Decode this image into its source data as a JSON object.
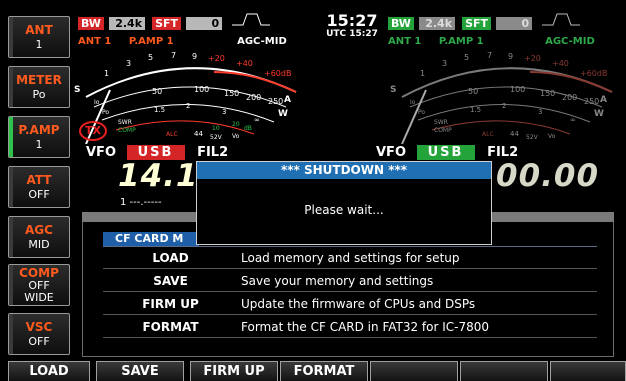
{
  "side_buttons": [
    {
      "title": "ANT",
      "value": "1"
    },
    {
      "title": "METER",
      "value": "Po"
    },
    {
      "title": "P.AMP",
      "value": "1"
    },
    {
      "title": "ATT",
      "value": "OFF"
    },
    {
      "title": "AGC",
      "value": "MID"
    },
    {
      "title": "COMP",
      "value": "OFF",
      "value2": "WIDE"
    },
    {
      "title": "VSC",
      "value": "OFF"
    }
  ],
  "left_top": {
    "bw_label": "BW",
    "bw_value": "2.4k",
    "sft_label": "SFT",
    "sft_value": "0",
    "ant": "ANT 1",
    "pamp": "P.AMP 1",
    "agc": "AGC-MID"
  },
  "clock": {
    "time": "15:27",
    "utc": "UTC 15:27"
  },
  "right_top": {
    "bw_label": "BW",
    "bw_value": "2.4k",
    "sft_label": "SFT",
    "sft_value": "0",
    "ant": "ANT 1",
    "pamp": "P.AMP 1",
    "agc": "AGC-MID"
  },
  "meter": {
    "s_scale": [
      "S",
      "1",
      "3",
      "5",
      "7",
      "9",
      "+20",
      "+40",
      "+60dB"
    ],
    "po_scale": [
      "Po",
      "0",
      "50",
      "100",
      "150",
      "200",
      "250",
      "W"
    ],
    "swr_scale": [
      "SWR",
      "1",
      "1.5",
      "2",
      "3",
      "∞"
    ],
    "comp_scale": [
      "COMP",
      "ALC",
      "10",
      "20",
      "dB"
    ],
    "vd_scale": [
      "44",
      "52V",
      "Vo"
    ],
    "id_label": "Io",
    "a_label": "A",
    "tx_label": "TX"
  },
  "vfo_left": {
    "label": "VFO",
    "mode": "USB",
    "filter": "FIL2",
    "freq_visible": "14.1",
    "sub_digits": "1 ---.-----"
  },
  "vfo_right": {
    "label": "VFO",
    "mode": "USB",
    "filter": "FIL2",
    "freq_visible": "00.00"
  },
  "colors": {
    "mode_left": "#d42626",
    "mode_right": "#23a33a",
    "accent": "#ff5a1e",
    "indicator_on": "#2ec14c",
    "dialog_bar": "#1f6fb2"
  },
  "cf_card": {
    "title": "CF CARD M",
    "rows": [
      {
        "key": "LOAD",
        "desc": "Load memory and settings for setup"
      },
      {
        "key": "SAVE",
        "desc": "Save your memory and settings"
      },
      {
        "key": "FIRM UP",
        "desc": "Update the firmware of CPUs and DSPs"
      },
      {
        "key": "FORMAT",
        "desc": "Format the CF CARD in FAT32 for IC-7800"
      }
    ]
  },
  "dialog": {
    "title": "*** SHUTDOWN ***",
    "message": "Please wait..."
  },
  "bottom_buttons": [
    "LOAD",
    "SAVE",
    "FIRM UP",
    "FORMAT",
    "",
    "",
    ""
  ]
}
